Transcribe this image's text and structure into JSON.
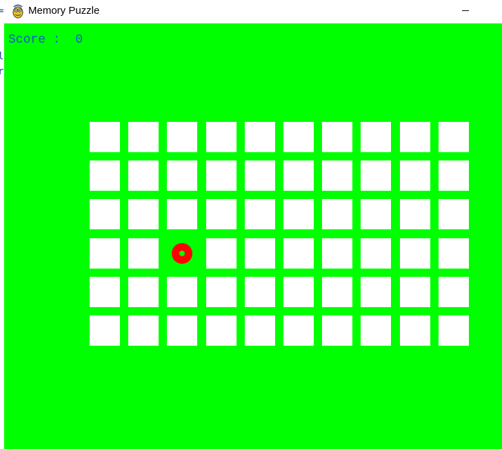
{
  "window": {
    "title": "Memory Puzzle",
    "icon": "pygame-snake-icon",
    "minimize_icon": "minimize-icon"
  },
  "background_fragments": [
    "=",
    "l",
    "r"
  ],
  "colors": {
    "background": "#00ff00",
    "tile": "#ffffff",
    "score_text": "#0a5bd1",
    "shape": "#ff0000"
  },
  "game": {
    "score_label": "Score :",
    "score_value": "0",
    "rows": 6,
    "columns": 10,
    "revealed": [
      {
        "row": 4,
        "col": 3,
        "shape": "donut",
        "color": "#ff0000"
      }
    ]
  }
}
